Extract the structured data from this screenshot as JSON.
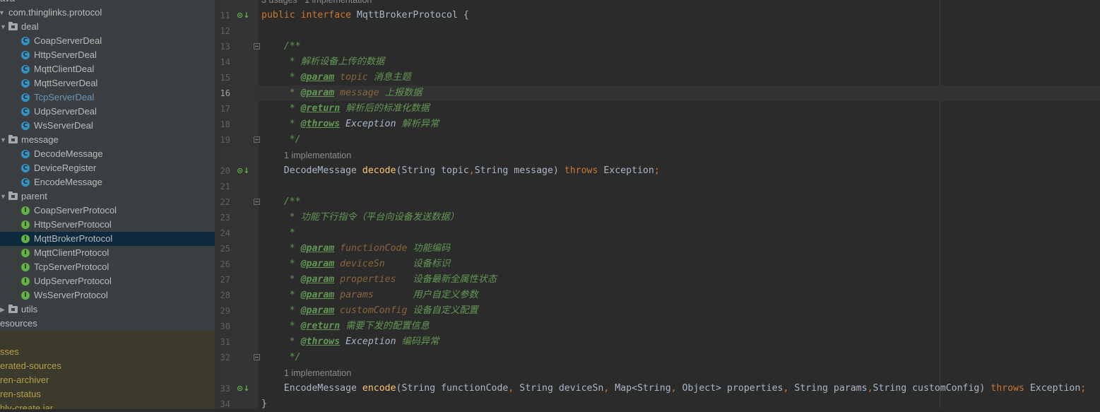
{
  "sidebar": {
    "rows": [
      {
        "label": "ava",
        "kind": "none",
        "indent": 0,
        "arrow": false
      },
      {
        "label": "com.thinglinks.protocol",
        "kind": "none",
        "indent": 0,
        "arrow": true
      },
      {
        "label": "deal",
        "kind": "folder",
        "indent": 1,
        "arrow": true
      },
      {
        "label": "CoapServerDeal",
        "kind": "class",
        "indent": 2
      },
      {
        "label": "HttpServerDeal",
        "kind": "class",
        "indent": 2
      },
      {
        "label": "MqttClientDeal",
        "kind": "class",
        "indent": 2
      },
      {
        "label": "MqttServerDeal",
        "kind": "class",
        "indent": 2
      },
      {
        "label": "TcpServerDeal",
        "kind": "class",
        "indent": 2,
        "modified": true
      },
      {
        "label": "UdpServerDeal",
        "kind": "class",
        "indent": 2
      },
      {
        "label": "WsServerDeal",
        "kind": "class",
        "indent": 2
      },
      {
        "label": "message",
        "kind": "folder",
        "indent": 1,
        "arrow": true
      },
      {
        "label": "DecodeMessage",
        "kind": "class",
        "indent": 2
      },
      {
        "label": "DeviceRegister",
        "kind": "class",
        "indent": 2
      },
      {
        "label": "EncodeMessage",
        "kind": "class",
        "indent": 2
      },
      {
        "label": "parent",
        "kind": "folder",
        "indent": 1,
        "arrow": true
      },
      {
        "label": "CoapServerProtocol",
        "kind": "interface",
        "indent": 2
      },
      {
        "label": "HttpServerProtocol",
        "kind": "interface",
        "indent": 2
      },
      {
        "label": "MqttBrokerProtocol",
        "kind": "interface",
        "indent": 2,
        "selected": true
      },
      {
        "label": "MqttClientProtocol",
        "kind": "interface",
        "indent": 2
      },
      {
        "label": "TcpServerProtocol",
        "kind": "interface",
        "indent": 2
      },
      {
        "label": "UdpServerProtocol",
        "kind": "interface",
        "indent": 2
      },
      {
        "label": "WsServerProtocol",
        "kind": "interface",
        "indent": 2
      },
      {
        "label": "utils",
        "kind": "folder",
        "indent": 1,
        "arrow": true,
        "collapsed": true
      },
      {
        "label": "esources",
        "kind": "none",
        "indent": 0
      },
      {
        "label": "",
        "kind": "none",
        "indent": 0
      },
      {
        "label": "sses",
        "kind": "none",
        "indent": 0,
        "generated": true
      },
      {
        "label": "erated-sources",
        "kind": "none",
        "indent": 0,
        "generated": true
      },
      {
        "label": "ren-archiver",
        "kind": "none",
        "indent": 0,
        "generated": true
      },
      {
        "label": "ren-status",
        "kind": "none",
        "indent": 0,
        "generated": true
      },
      {
        "label": "hly-create.jar",
        "kind": "none",
        "indent": 0,
        "generated": true
      }
    ],
    "badge_class": "C",
    "badge_interface": "I"
  },
  "editor": {
    "top_hint": "3 usages   1 implementation",
    "implementation_hint": "1 implementation",
    "current_line": 16,
    "line_numbers": [
      "11",
      "12",
      "13",
      "14",
      "15",
      "16",
      "17",
      "18",
      "19",
      "20",
      "21",
      "22",
      "23",
      "24",
      "25",
      "26",
      "27",
      "28",
      "29",
      "30",
      "31",
      "32",
      "33",
      "34"
    ],
    "gutter_marker": "⊙↓",
    "lines": [
      {
        "no": "11",
        "tokens": [
          [
            "kw",
            "public "
          ],
          [
            "kw",
            "interface "
          ],
          [
            "p",
            "MqttBrokerProtocol {"
          ]
        ]
      },
      {
        "no": "12",
        "tokens": []
      },
      {
        "no": "13",
        "tokens": [
          [
            "doc",
            "    /**"
          ]
        ]
      },
      {
        "no": "14",
        "tokens": [
          [
            "doc",
            "     * 解析设备上传的数据"
          ]
        ]
      },
      {
        "no": "15",
        "tokens": [
          [
            "doc",
            "     * "
          ],
          [
            "doctag",
            "@param"
          ],
          [
            "docparam",
            " topic"
          ],
          [
            "doc",
            " 消息主题"
          ]
        ]
      },
      {
        "no": "16",
        "tokens": [
          [
            "doc",
            "     * "
          ],
          [
            "doctag",
            "@param"
          ],
          [
            "docparam",
            " message"
          ],
          [
            "doc",
            " 上报数据"
          ]
        ]
      },
      {
        "no": "17",
        "tokens": [
          [
            "doc",
            "     * "
          ],
          [
            "doctag",
            "@return"
          ],
          [
            "doc",
            " 解析后的标准化数据"
          ]
        ]
      },
      {
        "no": "18",
        "tokens": [
          [
            "doc",
            "     * "
          ],
          [
            "doctag",
            "@throws"
          ],
          [
            "docref",
            " Exception"
          ],
          [
            "doc",
            " 解析异常"
          ]
        ]
      },
      {
        "no": "19",
        "tokens": [
          [
            "doc",
            "     */"
          ]
        ]
      },
      {
        "no": "20",
        "tokens": [
          [
            "p",
            "    DecodeMessage "
          ],
          [
            "fn",
            "decode"
          ],
          [
            "p",
            "(String topic"
          ],
          [
            "kw",
            ","
          ],
          [
            "p",
            "String message) "
          ],
          [
            "kw",
            "throws "
          ],
          [
            "p",
            "Exception"
          ],
          [
            "kw",
            ";"
          ]
        ]
      },
      {
        "no": "21",
        "tokens": []
      },
      {
        "no": "22",
        "tokens": [
          [
            "doc",
            "    /**"
          ]
        ]
      },
      {
        "no": "23",
        "tokens": [
          [
            "doc",
            "     * 功能下行指令（平台向设备发送数据）"
          ]
        ]
      },
      {
        "no": "24",
        "tokens": [
          [
            "doc",
            "     *"
          ]
        ]
      },
      {
        "no": "25",
        "tokens": [
          [
            "doc",
            "     * "
          ],
          [
            "doctag",
            "@param"
          ],
          [
            "docparam",
            " functionCode"
          ],
          [
            "doc",
            " 功能编码"
          ]
        ]
      },
      {
        "no": "26",
        "tokens": [
          [
            "doc",
            "     * "
          ],
          [
            "doctag",
            "@param"
          ],
          [
            "docparam",
            " deviceSn"
          ],
          [
            "doc",
            "     设备标识"
          ]
        ]
      },
      {
        "no": "27",
        "tokens": [
          [
            "doc",
            "     * "
          ],
          [
            "doctag",
            "@param"
          ],
          [
            "docparam",
            " properties"
          ],
          [
            "doc",
            "   设备最新全属性状态"
          ]
        ]
      },
      {
        "no": "28",
        "tokens": [
          [
            "doc",
            "     * "
          ],
          [
            "doctag",
            "@param"
          ],
          [
            "docparam",
            " params"
          ],
          [
            "doc",
            "       用户自定义参数"
          ]
        ]
      },
      {
        "no": "29",
        "tokens": [
          [
            "doc",
            "     * "
          ],
          [
            "doctag",
            "@param"
          ],
          [
            "docparam",
            " customConfig"
          ],
          [
            "doc",
            " 设备自定义配置"
          ]
        ]
      },
      {
        "no": "30",
        "tokens": [
          [
            "doc",
            "     * "
          ],
          [
            "doctag",
            "@return"
          ],
          [
            "doc",
            " 需要下发的配置信息"
          ]
        ]
      },
      {
        "no": "31",
        "tokens": [
          [
            "doc",
            "     * "
          ],
          [
            "doctag",
            "@throws"
          ],
          [
            "docref",
            " Exception"
          ],
          [
            "doc",
            " 编码异常"
          ]
        ]
      },
      {
        "no": "32",
        "tokens": [
          [
            "doc",
            "     */"
          ]
        ]
      },
      {
        "no": "33",
        "tokens": [
          [
            "p",
            "    EncodeMessage "
          ],
          [
            "fn",
            "encode"
          ],
          [
            "p",
            "(String functionCode"
          ],
          [
            "kw",
            ", "
          ],
          [
            "p",
            "String deviceSn"
          ],
          [
            "kw",
            ", "
          ],
          [
            "p",
            "Map<String"
          ],
          [
            "kw",
            ", "
          ],
          [
            "p",
            "Object> properties"
          ],
          [
            "kw",
            ", "
          ],
          [
            "p",
            "String params"
          ],
          [
            "kw",
            ","
          ],
          [
            "p",
            "String customConfig) "
          ],
          [
            "kw",
            "throws "
          ],
          [
            "p",
            "Exception"
          ],
          [
            "kw",
            ";"
          ]
        ]
      },
      {
        "no": "34",
        "tokens": [
          [
            "p",
            "}"
          ]
        ]
      }
    ]
  }
}
